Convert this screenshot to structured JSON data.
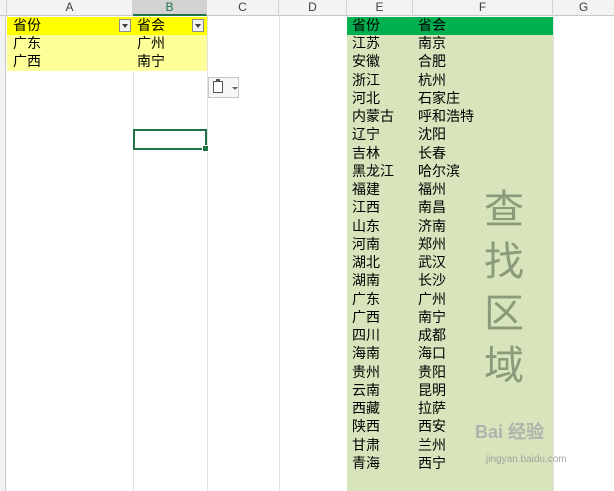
{
  "column_headers": [
    "A",
    "B",
    "C",
    "D",
    "E",
    "F",
    "G"
  ],
  "selected_column": "B",
  "left_table": {
    "header": [
      "省份",
      "省会"
    ],
    "rows": [
      [
        "广东",
        "广州"
      ],
      [
        "广西",
        "南宁"
      ]
    ]
  },
  "right_table": {
    "header": [
      "省份",
      "省会"
    ],
    "rows": [
      [
        "江苏",
        "南京"
      ],
      [
        "安徽",
        "合肥"
      ],
      [
        "浙江",
        "杭州"
      ],
      [
        "河北",
        "石家庄"
      ],
      [
        "内蒙古",
        "呼和浩特"
      ],
      [
        "辽宁",
        "沈阳"
      ],
      [
        "吉林",
        "长春"
      ],
      [
        "黑龙江",
        "哈尔滨"
      ],
      [
        "福建",
        "福州"
      ],
      [
        "江西",
        "南昌"
      ],
      [
        "山东",
        "济南"
      ],
      [
        "河南",
        "郑州"
      ],
      [
        "湖北",
        "武汉"
      ],
      [
        "湖南",
        "长沙"
      ],
      [
        "广东",
        "广州"
      ],
      [
        "广西",
        "南宁"
      ],
      [
        "四川",
        "成都"
      ],
      [
        "海南",
        "海口"
      ],
      [
        "贵州",
        "贵阳"
      ],
      [
        "云南",
        "昆明"
      ],
      [
        "西藏",
        "拉萨"
      ],
      [
        "陕西",
        "西安"
      ],
      [
        "甘肃",
        "兰州"
      ],
      [
        "青海",
        "西宁"
      ]
    ]
  },
  "search_area_label": [
    "查",
    "找",
    "区",
    "域"
  ],
  "watermark": "Bai 经验",
  "watermark_url": "jingyan.baidu.com",
  "colors": {
    "header_yellow": "#ffff00",
    "fill_yellow": "#ffff99",
    "header_green": "#00b050",
    "fill_green": "#d8e4bc",
    "selection": "#217346"
  }
}
